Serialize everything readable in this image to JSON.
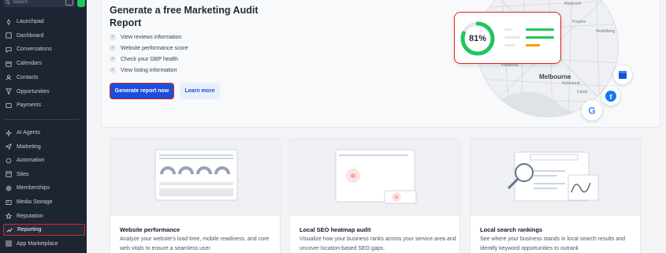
{
  "sidebar": {
    "search_placeholder": "Search",
    "items_top": [
      {
        "label": "Launchpad",
        "icon": "rocket-icon"
      },
      {
        "label": "Dashboard",
        "icon": "dashboard-icon"
      },
      {
        "label": "Conversations",
        "icon": "chat-icon"
      },
      {
        "label": "Calendars",
        "icon": "calendar-icon"
      },
      {
        "label": "Contacts",
        "icon": "contacts-icon"
      },
      {
        "label": "Opportunities",
        "icon": "filter-icon"
      },
      {
        "label": "Payments",
        "icon": "payments-icon"
      }
    ],
    "items_bottom": [
      {
        "label": "AI Agents",
        "icon": "sparkle-icon"
      },
      {
        "label": "Marketing",
        "icon": "send-icon"
      },
      {
        "label": "Automation",
        "icon": "automation-icon"
      },
      {
        "label": "Sites",
        "icon": "sites-icon"
      },
      {
        "label": "Memberships",
        "icon": "memberships-icon"
      },
      {
        "label": "Media Storage",
        "icon": "media-icon"
      },
      {
        "label": "Reputation",
        "icon": "star-icon"
      },
      {
        "label": "Reporting",
        "icon": "trend-icon",
        "active": true
      },
      {
        "label": "App Marketplace",
        "icon": "marketplace-icon"
      }
    ]
  },
  "hero": {
    "title": "Generate a free Marketing Audit Report",
    "checklist": [
      "View reviews information",
      "Website performance score",
      "Check your GBP health",
      "View listing information"
    ],
    "primary_button": "Generate report now",
    "secondary_button": "Learn more",
    "score": "81%",
    "map_city": "Melbourne",
    "map_labels": [
      "Reservoir",
      "Preston",
      "Heidelberg",
      "Footscray",
      "Richmond",
      "Camb"
    ]
  },
  "colors": {
    "accent": "#1d4ed8",
    "score_green": "#22c55e",
    "highlight_border": "#dc2626"
  },
  "cards": [
    {
      "title": "Website performance",
      "desc": "Analyze your website's load time, mobile readiness, and core web vitals to ensure a seamless user"
    },
    {
      "title": "Local SEO heatmap audit",
      "desc": "Visualize how your business ranks across your service area and uncover location-based SEO gaps."
    },
    {
      "title": "Local search rankings",
      "desc": "See where your business stands in local search results and identify keyword opportunities to outrank"
    }
  ]
}
